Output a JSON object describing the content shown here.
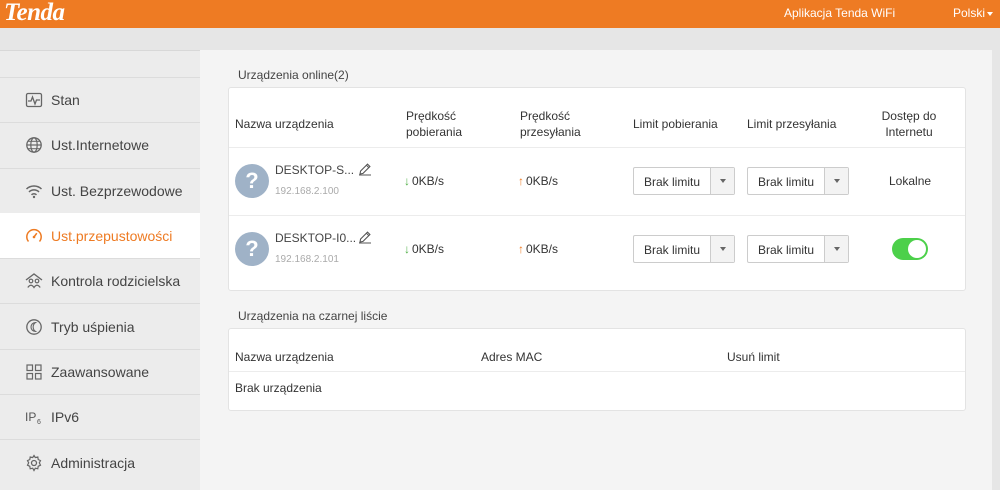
{
  "header": {
    "logo": "Tenda",
    "app_link": "Aplikacja Tenda WiFi",
    "language": "Polski"
  },
  "colors": {
    "brand": "#ee7b23",
    "toggle_on": "#4cd04a",
    "download_arrow": "#51b048",
    "upload_arrow": "#ee7b23"
  },
  "sidebar": {
    "items": [
      {
        "label": "Stan",
        "icon": "pulse-icon",
        "active": false
      },
      {
        "label": "Ust.Internetowe",
        "icon": "globe-icon",
        "active": false
      },
      {
        "label": "Ust. Bezprzewodowe",
        "icon": "wifi-icon",
        "active": false
      },
      {
        "label": "Ust.przepustowości",
        "icon": "speedometer-icon",
        "active": true
      },
      {
        "label": "Kontrola rodzicielska",
        "icon": "family-icon",
        "active": false
      },
      {
        "label": "Tryb uśpienia",
        "icon": "sleep-icon",
        "active": false
      },
      {
        "label": "Zaawansowane",
        "icon": "grid-icon",
        "active": false
      },
      {
        "label": "IPv6",
        "icon": "ipv6-icon",
        "active": false
      },
      {
        "label": "Administracja",
        "icon": "gear-icon",
        "active": false
      }
    ]
  },
  "online": {
    "title": "Urządzenia online(2)",
    "columns": {
      "name": "Nazwa urządzenia",
      "down_speed": [
        "Prędkość",
        "pobierania"
      ],
      "up_speed": [
        "Prędkość",
        "przesyłania"
      ],
      "down_limit": "Limit pobierania",
      "up_limit": "Limit przesyłania",
      "access": [
        "Dostęp do",
        "Internetu"
      ]
    },
    "devices": [
      {
        "avatar": "?",
        "name": "DESKTOP-S...",
        "ip": "192.168.2.100",
        "down_arrow": "↓",
        "down_speed": "0KB/s",
        "up_arrow": "↑",
        "up_speed": "0KB/s",
        "down_limit": "Brak limitu",
        "up_limit": "Brak limitu",
        "access_text": "Lokalne",
        "access_toggle": null
      },
      {
        "avatar": "?",
        "name": "DESKTOP-I0...",
        "ip": "192.168.2.101",
        "down_arrow": "↓",
        "down_speed": "0KB/s",
        "up_arrow": "↑",
        "up_speed": "0KB/s",
        "down_limit": "Brak limitu",
        "up_limit": "Brak limitu",
        "access_text": null,
        "access_toggle": true
      }
    ]
  },
  "blacklist": {
    "title": "Urządzenia na czarnej liście",
    "columns": {
      "name": "Nazwa urządzenia",
      "mac": "Adres MAC",
      "remove": "Usuń limit"
    },
    "empty_text": "Brak urządzenia"
  }
}
